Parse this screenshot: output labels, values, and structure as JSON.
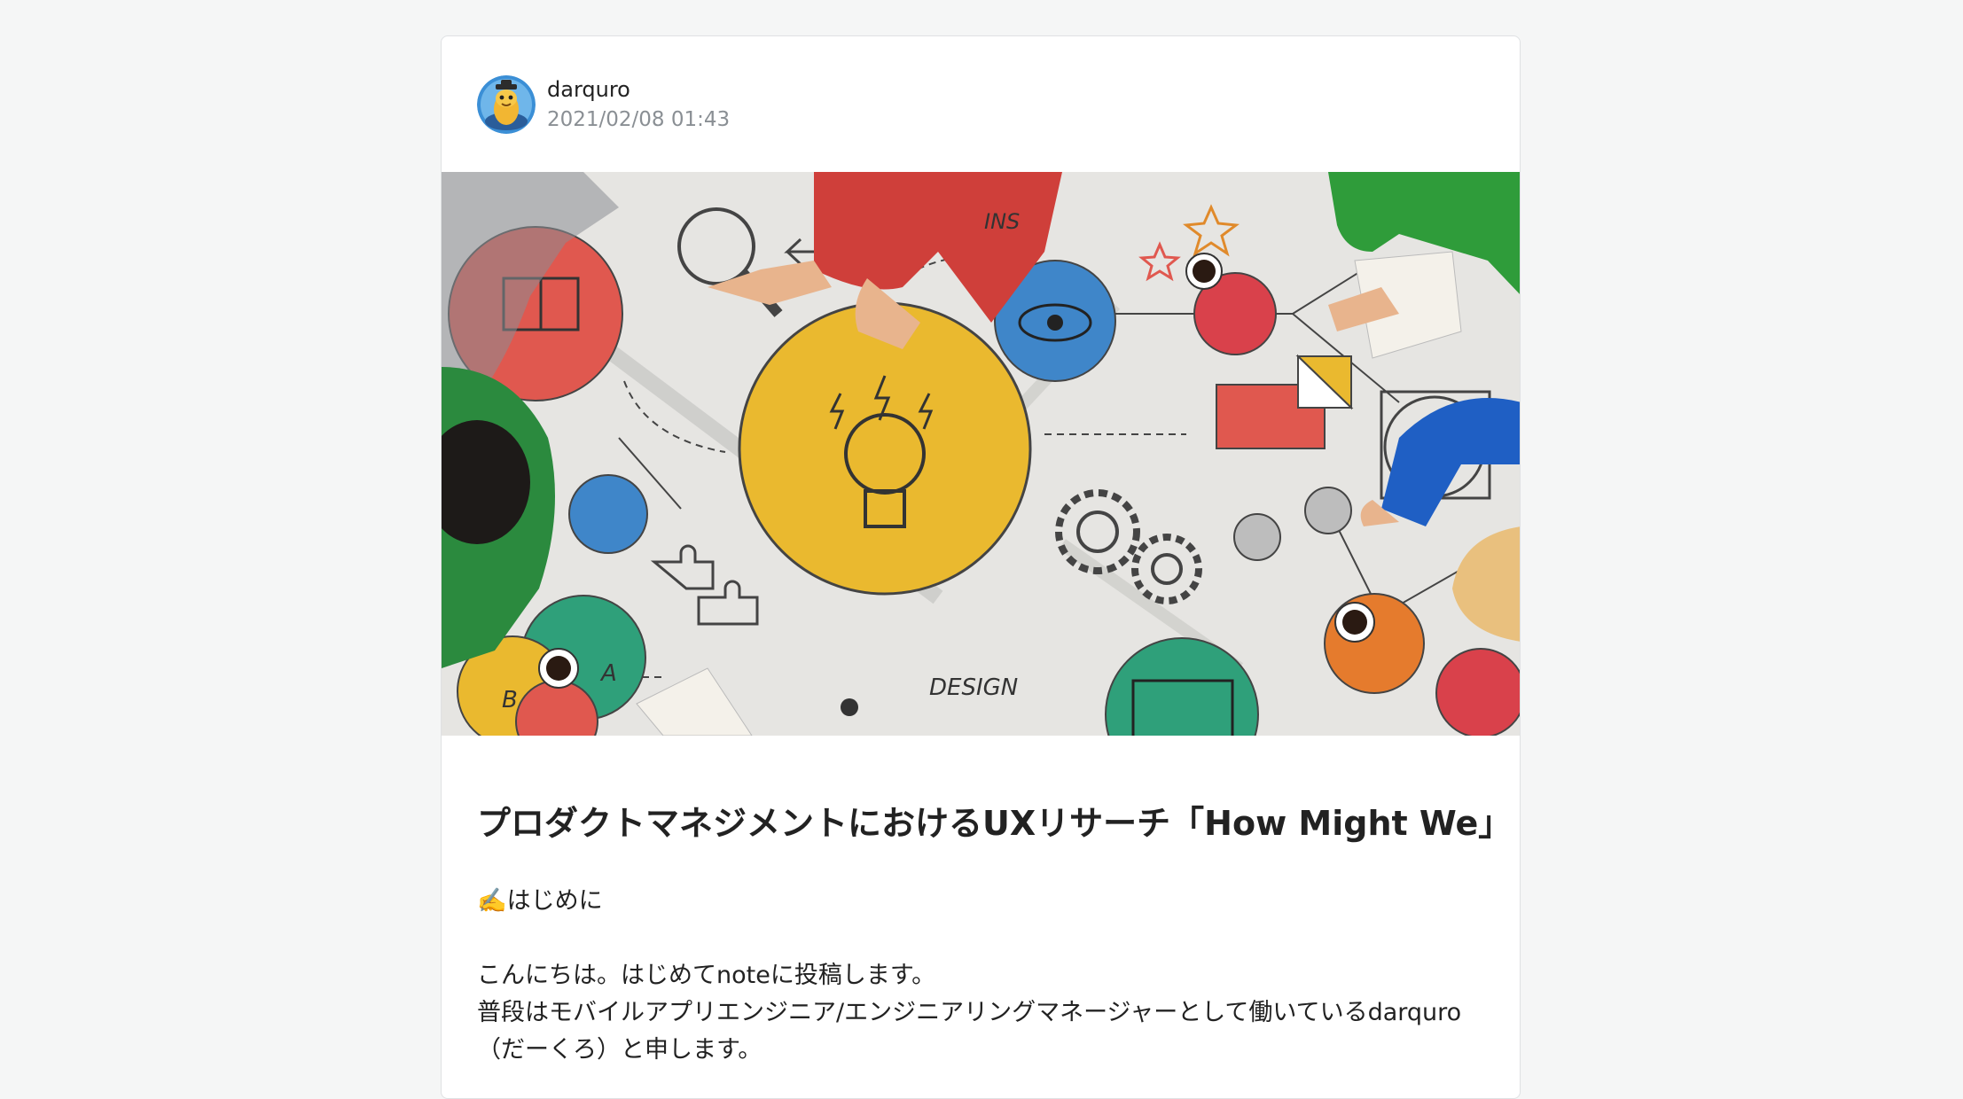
{
  "post": {
    "author": "darquro",
    "date": "2021/02/08 01:43",
    "avatar_icon": "avatar-character-icon",
    "hero_image_labels": [
      "INS",
      "DESIGN",
      "A",
      "B"
    ],
    "title": "プロダクトマネジメントにおけるUXリサーチ「How Might We」",
    "body": {
      "heading": "✍️はじめに",
      "line1": "こんにちは。はじめてnoteに投稿します。",
      "line2": "普段はモバイルアプリエンジニア/エンジニアリングマネージャーとして働いているdarquro",
      "line3": "（だーくろ）と申します。"
    }
  }
}
